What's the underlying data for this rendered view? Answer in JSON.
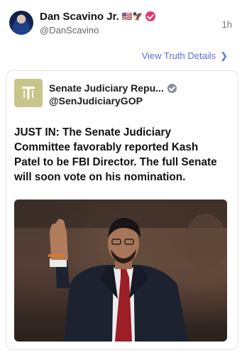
{
  "post": {
    "author": "Dan Scavino Jr.",
    "flags": "🇺🇸🦅",
    "handle": "@DanScavino",
    "time": "1h",
    "view_details": "View Truth Details",
    "chevron_icon": "chevron-right-icon"
  },
  "card": {
    "org_name": "Senate Judiciary Repu...",
    "org_handle": "@SenJudiciaryGOP",
    "text": "JUST IN: The Senate Judiciary Committee favorably reported Kash Patel to be FBI Director. The full Senate will soon vote on his nomination."
  },
  "colors": {
    "accent": "#5b6ee0",
    "verified_badge": "#e8336d",
    "org_verified_badge": "#8a8f9a",
    "org_logo_bg": "#c8c58a"
  }
}
